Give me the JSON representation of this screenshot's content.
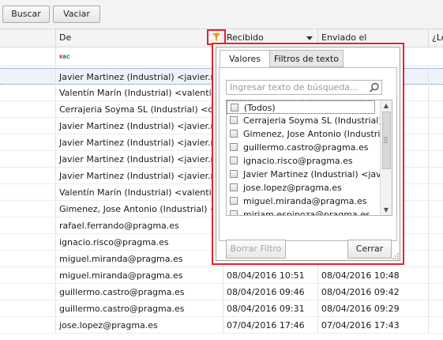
{
  "toolbar": {
    "search_label": "Buscar",
    "empty_label": "Vaciar"
  },
  "grid": {
    "columns": [
      "De",
      "Recibido",
      "Enviado el",
      "¿Le"
    ],
    "filter_row_icon_text": "RBC",
    "rows": [
      {
        "from": "Javier Martinez (Industrial) <javier.mar",
        "received": "",
        "sent": ""
      },
      {
        "from": "Valentín Marín (Industrial) <valentin.m",
        "received": "",
        "sent": ""
      },
      {
        "from": "Cerrajeria Soyma SL (Industrial) <cerraj",
        "received": "",
        "sent": ""
      },
      {
        "from": "Javier Martinez (Industrial) <javier.mar",
        "received": "",
        "sent": ""
      },
      {
        "from": "Javier Martinez (Industrial) <javier.mar",
        "received": "",
        "sent": ""
      },
      {
        "from": "Javier Martinez (Industrial) <javier.mar",
        "received": "",
        "sent": ""
      },
      {
        "from": "Javier Martinez (Industrial) <javier.mar",
        "received": "",
        "sent": ""
      },
      {
        "from": "Valentín Marín (Industrial) <valentin.m",
        "received": "",
        "sent": ""
      },
      {
        "from": "Gimenez, Jose Antonio (Industrial) <ant",
        "received": "",
        "sent": ""
      },
      {
        "from": "rafael.ferrando@pragma.es",
        "received": "",
        "sent": ""
      },
      {
        "from": "ignacio.risco@pragma.es",
        "received": "",
        "sent": ""
      },
      {
        "from": "miguel.miranda@pragma.es",
        "received": "",
        "sent": ""
      },
      {
        "from": "miguel.miranda@pragma.es",
        "received": "08/04/2016 10:51",
        "sent": "08/04/2016 10:48"
      },
      {
        "from": "guillermo.castro@pragma.es",
        "received": "08/04/2016 09:46",
        "sent": "08/04/2016 09:42"
      },
      {
        "from": "guillermo.castro@pragma.es",
        "received": "08/04/2016 09:31",
        "sent": "08/04/2016 09:29"
      },
      {
        "from": "jose.lopez@pragma.es",
        "received": "07/04/2016 17:46",
        "sent": "07/04/2016 17:43"
      }
    ]
  },
  "filter_popup": {
    "tabs": [
      "Valores",
      "Filtros de texto"
    ],
    "search_placeholder": "Ingresar texto de búsqueda...",
    "items": [
      "(Todos)",
      "Cerrajeria Soyma SL (Industrial) <ce",
      "Gimenez, Jose Antonio (Industrial) <",
      "guillermo.castro@pragma.es",
      "ignacio.risco@pragma.es",
      "Javier Martinez (Industrial) <javier.",
      "jose.lopez@pragma.es",
      "miguel.miranda@pragma.es",
      "miriam.espinoza@pragma.es"
    ],
    "clear_label": "Borrar Filtro",
    "close_label": "Cerrar"
  },
  "colors": {
    "highlight": "#e8202a",
    "selection_border": "#5a7fb5"
  }
}
